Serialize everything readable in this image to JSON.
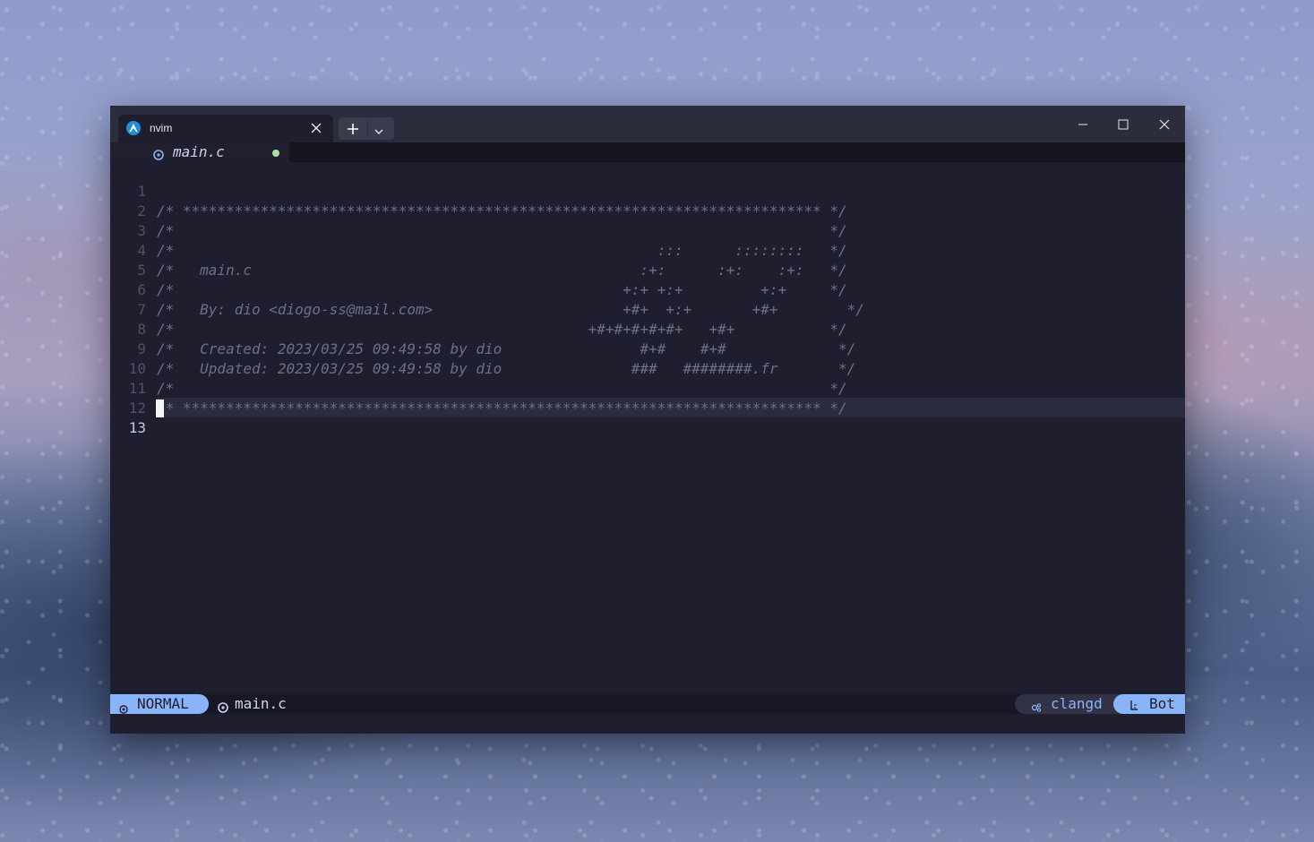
{
  "terminal": {
    "tab_title": "nvim",
    "tab_icon": "arch-linux-icon"
  },
  "bufferline": {
    "buffer_name": "main.c",
    "modified_indicator_color": "#a6e3a1"
  },
  "editor": {
    "current_line": 13,
    "lines": [
      {
        "num": "1",
        "text": "/* ************************************************************************** */"
      },
      {
        "num": "2",
        "text": "/*                                                                            */"
      },
      {
        "num": "3",
        "text": "/*                                                        :::      ::::::::   */"
      },
      {
        "num": "4",
        "text": "/*   main.c                                             :+:      :+:    :+:   */"
      },
      {
        "num": "5",
        "text": "/*                                                    +:+ +:+         +:+     */"
      },
      {
        "num": "6",
        "text": "/*   By: dio <diogo-ss@mail.com>                      +#+  +:+       +#+        */"
      },
      {
        "num": "7",
        "text": "/*                                                +#+#+#+#+#+   +#+           */"
      },
      {
        "num": "8",
        "text": "/*   Created: 2023/03/25 09:49:58 by dio                #+#    #+#             */"
      },
      {
        "num": "9",
        "text": "/*   Updated: 2023/03/25 09:49:58 by dio               ###   ########.fr       */"
      },
      {
        "num": "10",
        "text": "/*                                                                            */"
      },
      {
        "num": "11",
        "text": "/* ************************************************************************** */"
      },
      {
        "num": "12",
        "text": ""
      },
      {
        "num": "13",
        "text": ""
      }
    ]
  },
  "statusline": {
    "mode": "NORMAL",
    "file": "main.c",
    "lsp": "clangd",
    "position": "Bot"
  },
  "colors": {
    "accent": "#89b4fa",
    "editor_bg": "#1e1e2e",
    "comment": "#6c7086"
  }
}
